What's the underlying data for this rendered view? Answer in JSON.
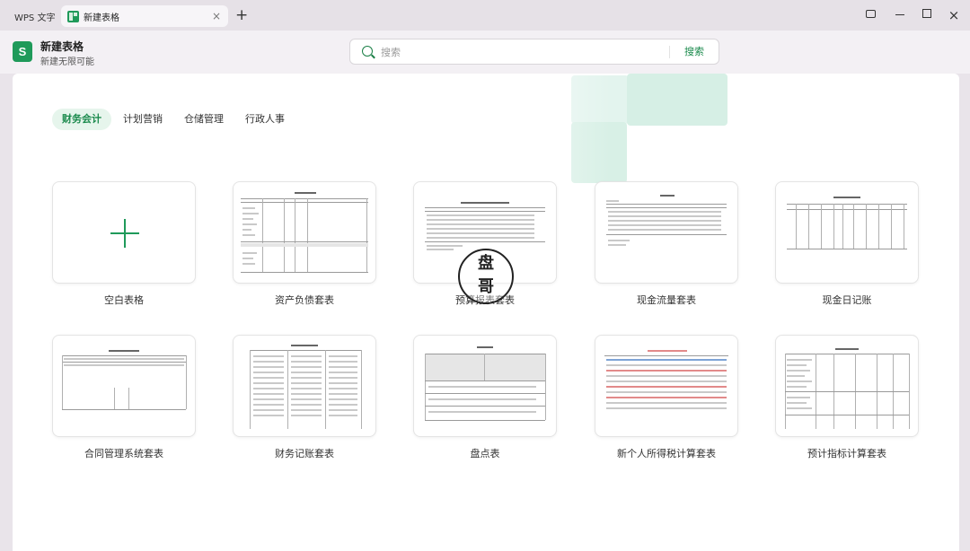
{
  "titlebar": {
    "app_tab_label": "WPS 文字",
    "active_tab_label": "新建表格",
    "close_glyph": "×",
    "add_glyph": "+"
  },
  "header": {
    "logo_letter": "S",
    "title": "新建表格",
    "subtitle": "新建无限可能"
  },
  "search": {
    "placeholder": "搜索",
    "value": "",
    "button_label": "搜索"
  },
  "categories": [
    {
      "label": "财务会计",
      "active": true
    },
    {
      "label": "计划营销",
      "active": false
    },
    {
      "label": "仓储管理",
      "active": false
    },
    {
      "label": "行政人事",
      "active": false
    }
  ],
  "templates": [
    {
      "label": "空白表格"
    },
    {
      "label": "资产负债套表"
    },
    {
      "label": "预算报表套表"
    },
    {
      "label": "现金流量套表"
    },
    {
      "label": "现金日记账"
    },
    {
      "label": "合同管理系统套表"
    },
    {
      "label": "财务记账套表"
    },
    {
      "label": "盘点表"
    },
    {
      "label": "新个人所得税计算套表"
    },
    {
      "label": "预计指标计算套表"
    }
  ],
  "watermark": {
    "line1": "盘",
    "line2": "哥"
  },
  "colors": {
    "accent": "#1f9a5a",
    "accent_text": "#1a8a4c",
    "active_tab_bg": "#e6f5ec"
  }
}
